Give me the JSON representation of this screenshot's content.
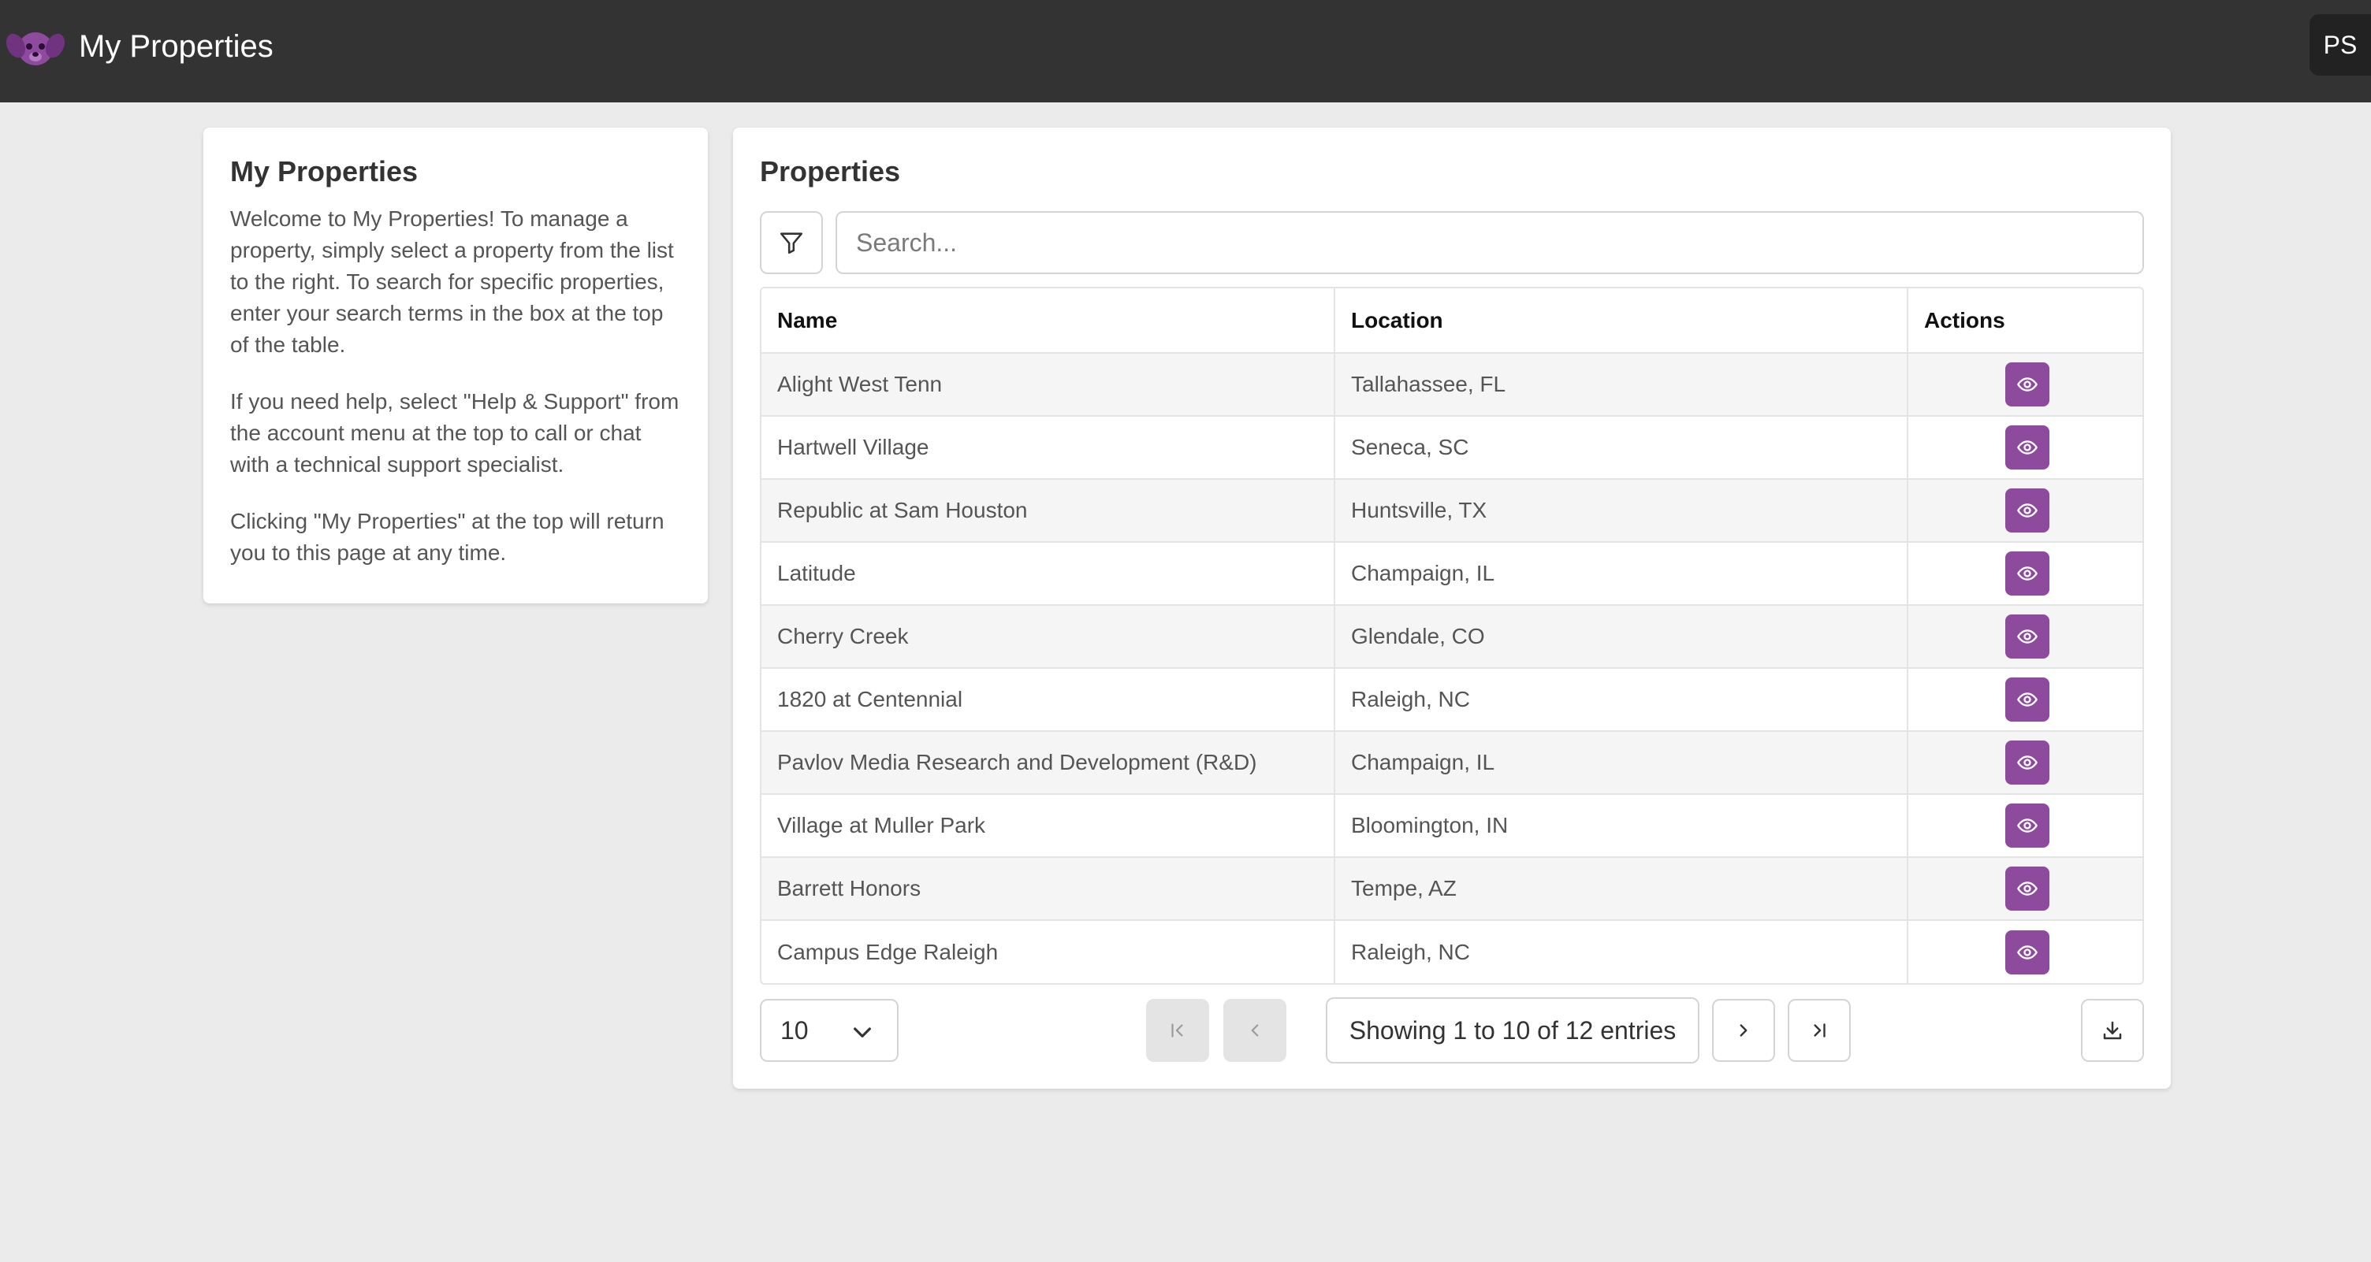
{
  "header": {
    "app_title": "My Properties",
    "avatar_initials": "PS",
    "brand_color": "#8e4b9e",
    "bar_color": "#333333"
  },
  "info": {
    "title": "My Properties",
    "paragraphs": [
      "Welcome to My Properties! To manage a property, simply select a property from the list to the right. To search for specific properties, enter your search terms in the box at the top of the table.",
      "If you need help, select \"Help & Support\" from the account menu at the top to call or chat with a technical support specialist.",
      "Clicking \"My Properties\" at the top will return you to this page at any time."
    ]
  },
  "properties": {
    "title": "Properties",
    "search_placeholder": "Search...",
    "columns": [
      "Name",
      "Location",
      "Actions"
    ],
    "rows": [
      {
        "name": "Alight West Tenn",
        "location": "Tallahassee, FL"
      },
      {
        "name": "Hartwell Village",
        "location": "Seneca, SC"
      },
      {
        "name": "Republic at Sam Houston",
        "location": "Huntsville, TX"
      },
      {
        "name": "Latitude",
        "location": "Champaign, IL"
      },
      {
        "name": "Cherry Creek",
        "location": "Glendale, CO"
      },
      {
        "name": "1820 at Centennial",
        "location": "Raleigh, NC"
      },
      {
        "name": "Pavlov Media Research and Development (R&D)",
        "location": "Champaign, IL"
      },
      {
        "name": "Village at Muller Park",
        "location": "Bloomington, IN"
      },
      {
        "name": "Barrett Honors",
        "location": "Tempe, AZ"
      },
      {
        "name": "Campus Edge Raleigh",
        "location": "Raleigh, NC"
      }
    ],
    "action_icon": "eye-icon"
  },
  "pager": {
    "page_size": "10",
    "status": "Showing 1 to 10 of 12 entries",
    "first_icon": "first-page-icon",
    "prev_icon": "chevron-left-icon",
    "next_icon": "chevron-right-icon",
    "last_icon": "last-page-icon",
    "download_icon": "download-icon"
  }
}
